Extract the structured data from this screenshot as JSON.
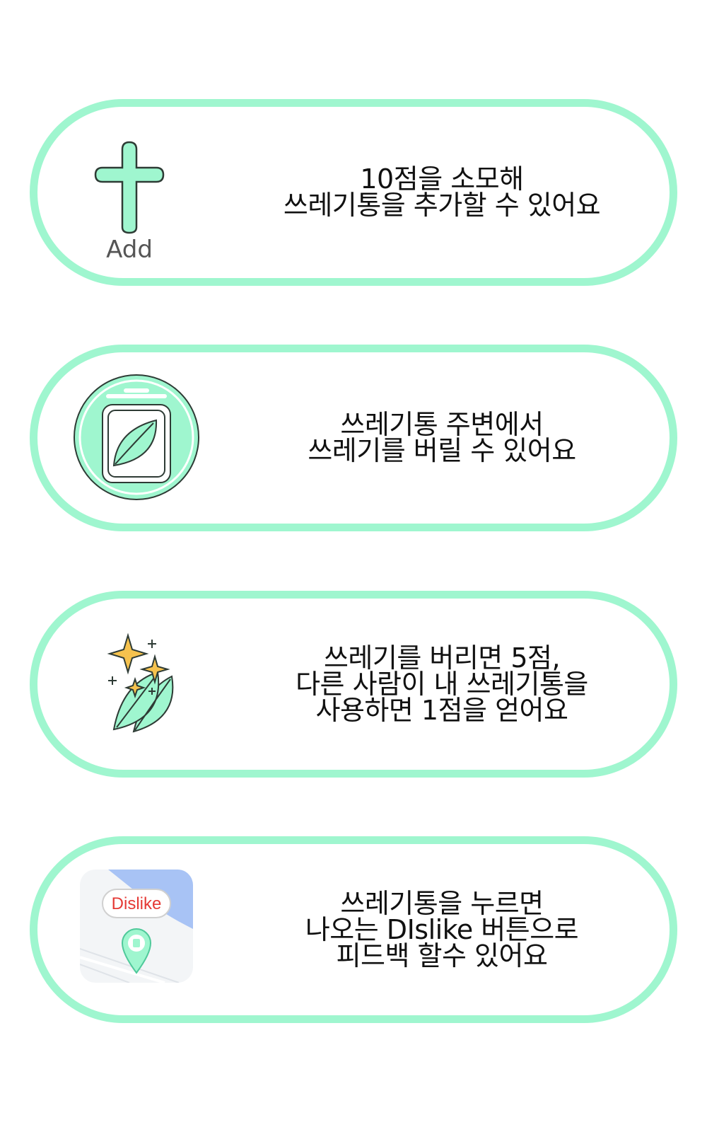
{
  "colors": {
    "accent": "#9ff6cf",
    "accent_stroke": "#2e3b35",
    "star": "#f6c24e",
    "dislike_text": "#e53935",
    "map_blue": "#a8c3f5"
  },
  "cards": [
    {
      "icon": "add-plus-icon",
      "icon_label": "Add",
      "lines": [
        "10점을 소모해",
        "쓰레기통을 추가할 수 있어요"
      ]
    },
    {
      "icon": "trash-can-leaf-icon",
      "lines": [
        "쓰레기통 주변에서",
        "쓰레기를 버릴 수 있어요"
      ]
    },
    {
      "icon": "sparkle-leaves-icon",
      "lines": [
        "쓰레기를 버리면 5점,",
        "다른 사람이 내 쓰레기통을",
        "사용하면 1점을 얻어요"
      ]
    },
    {
      "icon": "dislike-map-icon",
      "icon_label": "Dislike",
      "lines": [
        "쓰레기통을 누르면",
        "나오는 DIslike 버튼으로",
        "피드백 할수 있어요"
      ]
    }
  ]
}
